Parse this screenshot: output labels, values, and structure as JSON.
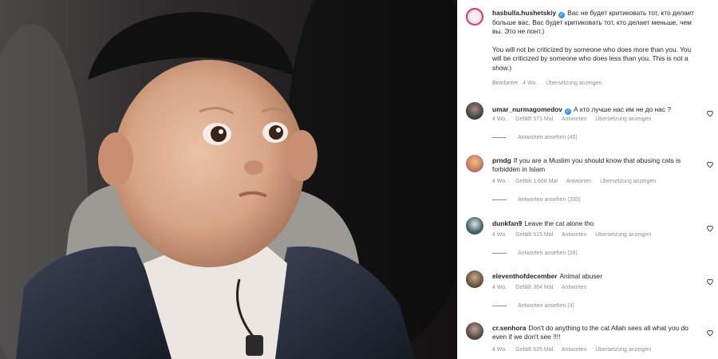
{
  "post": {
    "username": "hasbulla.hushetskiy",
    "caption_ru": "Вас не будет критиковать тот, кто делает больше вас. Вас будет критиковать тот, кто делает меньше, чем вы. Это не понт.)",
    "caption_en": "You will not be criticized by someone who does more than you. You will be criticized by someone who does less than you. This is not a show.)",
    "edited": "Bearbeitet · 4 Wo.",
    "translate": "Übersetzung anzeigen"
  },
  "comments": [
    {
      "username": "umar_nurmagomedov",
      "verified": true,
      "text": "А кто лучше нас им не до нас ?",
      "age": "4 Wo.",
      "likes": "Gefällt 571 Mal",
      "reply": "Antworten",
      "translate": "Übersetzung anzeigen",
      "view_replies": "Antworten ansehen (45)"
    },
    {
      "username": "prndg",
      "verified": false,
      "text": "If you are a Muslim you should know that abusing cats is forbidden in Islam",
      "age": "4 Wo.",
      "likes": "Gefällt 1.668 Mal",
      "reply": "Antworten",
      "translate": "Übersetzung anzeigen",
      "view_replies": "Antworten ansehen (200)"
    },
    {
      "username": "dunkfan9",
      "verified": false,
      "text": "Leave the cat alone tho",
      "age": "4 Wo.",
      "likes": "Gefällt 615 Mal",
      "reply": "Antworten",
      "translate": "Übersetzung anzeigen",
      "view_replies": "Antworten ansehen (28)"
    },
    {
      "username": "eleventhofdecember",
      "verified": false,
      "text": "Animal abuser",
      "age": "4 Wo.",
      "likes": "Gefällt 364 Mal",
      "reply": "Antworten",
      "translate": "",
      "view_replies": "Antworten ansehen (4)"
    },
    {
      "username": "cr.senhora",
      "verified": false,
      "text": "Don't do anything to the cat Allah sees all what you do even if we don't see !!!!",
      "age": "4 Wo.",
      "likes": "Gefällt 635 Mal",
      "reply": "Antworten",
      "translate": "Übersetzung anzeigen",
      "view_replies": ""
    }
  ],
  "colors": {
    "link": "#8e8e8e",
    "verified": "#3897f0",
    "text": "#262626"
  }
}
